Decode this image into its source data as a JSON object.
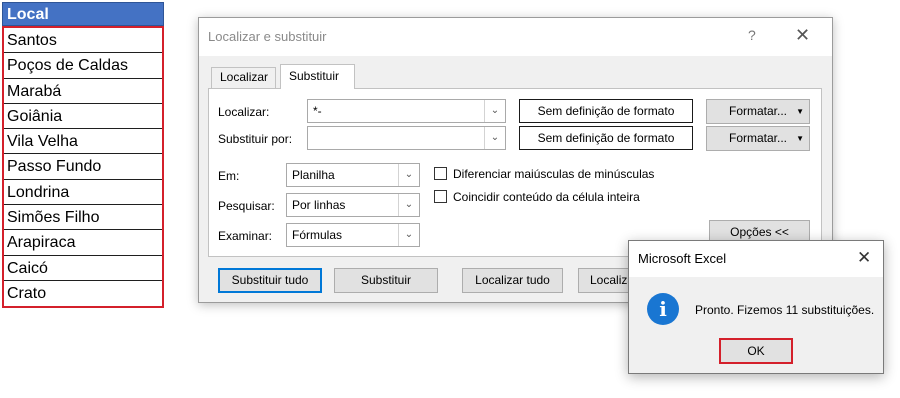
{
  "sheet": {
    "header": "Local",
    "cells": [
      "Santos",
      "Poços de Caldas",
      "Marabá",
      "Goiânia",
      "Vila Velha",
      "Passo Fundo",
      "Londrina",
      "Simões Filho",
      "Arapiraca",
      "Caicó",
      "Crato"
    ],
    "header_color": "#4472c4",
    "highlight_color": "#d4202b"
  },
  "dialog": {
    "title": "Localizar e substituir",
    "help_glyph": "?",
    "close_glyph": "✕",
    "tabs": [
      {
        "label": "Localizar",
        "active": false
      },
      {
        "label": "Substituir",
        "active": true
      }
    ],
    "find_label": "Localizar:",
    "find_value": "*-",
    "replace_label": "Substituir por:",
    "replace_value": "",
    "no_format_label": "Sem definição de formato",
    "format_button": "Formatar...",
    "within_label": "Em:",
    "within_value": "Planilha",
    "search_label": "Pesquisar:",
    "search_value": "Por linhas",
    "lookin_label": "Examinar:",
    "lookin_value": "Fórmulas",
    "match_case_label": "Diferenciar maiúsculas de minúsculas",
    "match_case_checked": false,
    "match_entire_label": "Coincidir conteúdo da célula inteira",
    "match_entire_checked": false,
    "options_button": "Opções <<",
    "replace_all_button": "Substituir tudo",
    "replace_button": "Substituir",
    "find_all_button": "Localizar tudo",
    "find_next_button": "Localizar próxima"
  },
  "msgbox": {
    "title": "Microsoft Excel",
    "close_glyph": "✕",
    "icon": "info-icon",
    "icon_glyph": "i",
    "message": "Pronto. Fizemos 11 substituições.",
    "ok_button": "OK"
  }
}
